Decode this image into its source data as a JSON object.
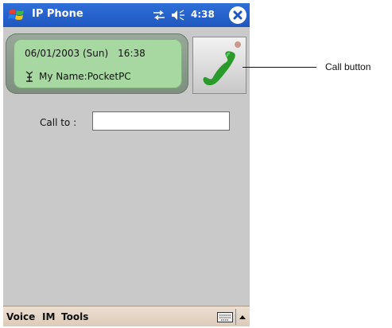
{
  "titlebar": {
    "app_title": "IP Phone",
    "time": "4:38",
    "icons": [
      "windows-start-icon",
      "sync-icon",
      "volume-icon",
      "close-icon"
    ]
  },
  "status_panel": {
    "date": "06/01/2003 (Sun)",
    "time": "16:38",
    "name_line": "My Name:PocketPC",
    "antenna_icon": "antenna-icon"
  },
  "call_button": {
    "icon": "phone-handset-icon"
  },
  "call_to": {
    "label": "Call to :",
    "value": "",
    "placeholder": ""
  },
  "menubar": {
    "items": [
      "Voice",
      "IM",
      "Tools"
    ],
    "keyboard_icon": "keyboard-icon",
    "sip_arrow_icon": "up-arrow-icon"
  },
  "annotation": {
    "label": "Call button"
  },
  "colors": {
    "titlebar": "#2563c8",
    "panel_green": "#a8d8a2",
    "screen_bg": "#c9c9c9",
    "menubar": "#e4d6c6",
    "handset_green": "#2a9a2a"
  }
}
